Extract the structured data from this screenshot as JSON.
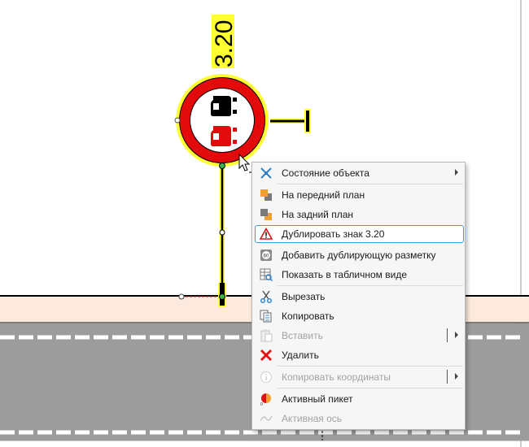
{
  "sign": {
    "code": "3.20",
    "name": "no-overtaking-sign",
    "ring_color": "#e20a0a",
    "car_colors": [
      "#000000",
      "#e20a0a"
    ],
    "selection_color": "#ffff33"
  },
  "road": {
    "sidewalk_color": "#fde9dd",
    "asphalt_color": "#9c9c9c",
    "marking_color": "#ffffff"
  },
  "context_menu": {
    "items": [
      {
        "key": "state",
        "label": "Состояние объекта",
        "icon": "object-state-icon",
        "submenu": true,
        "enabled": true
      },
      {
        "key": "front",
        "label": "На передний план",
        "icon": "bring-to-front-icon",
        "enabled": true
      },
      {
        "key": "back",
        "label": "На задний план",
        "icon": "send-to-back-icon",
        "enabled": true
      },
      {
        "key": "duplicate_sign",
        "label": "Дублировать знак 3.20",
        "icon": "warning-triangle-icon",
        "enabled": true,
        "highlighted": true
      },
      {
        "key": "add_marking",
        "label": "Добавить дублирующую разметку",
        "icon": "marking-icon",
        "enabled": true
      },
      {
        "key": "table_view",
        "label": "Показать в табличном виде",
        "icon": "table-view-icon",
        "enabled": true
      },
      {
        "key": "cut",
        "label": "Вырезать",
        "icon": "scissors-icon",
        "enabled": true
      },
      {
        "key": "copy",
        "label": "Копировать",
        "icon": "copy-icon",
        "enabled": true
      },
      {
        "key": "paste",
        "label": "Вставить",
        "icon": "paste-icon",
        "enabled": false,
        "submenu": true
      },
      {
        "key": "delete",
        "label": "Удалить",
        "icon": "delete-x-icon",
        "enabled": true
      },
      {
        "key": "copy_coords",
        "label": "Копировать координаты",
        "icon": "info-icon",
        "enabled": false,
        "submenu": true
      },
      {
        "key": "active_picket",
        "label": "Активный пикет",
        "icon": "picket-icon",
        "enabled": true
      },
      {
        "key": "active_axis",
        "label": "Активная ось",
        "icon": "axis-icon",
        "enabled": false
      }
    ]
  }
}
